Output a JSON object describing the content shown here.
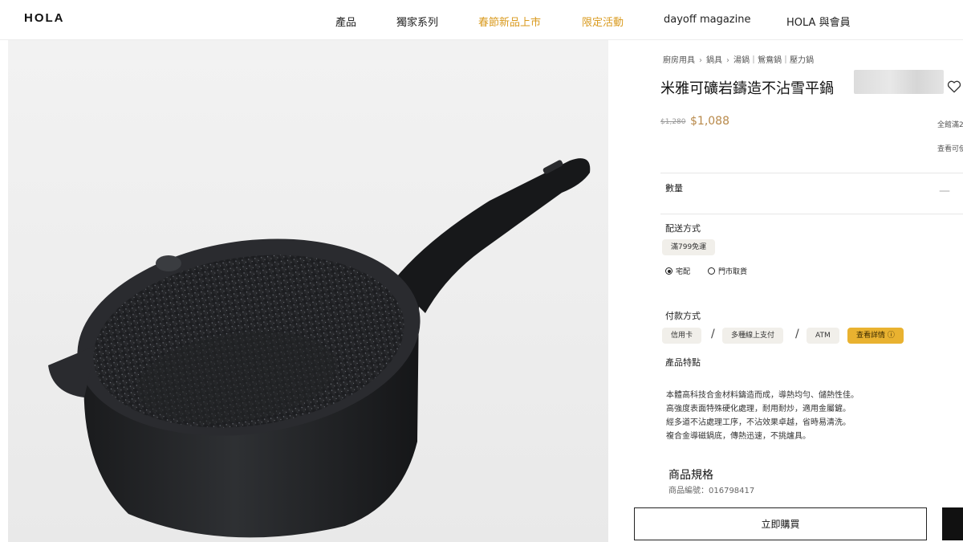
{
  "header": {
    "logo": "HOLA",
    "nav": [
      {
        "label": "產品",
        "highlight": false
      },
      {
        "label": "獨家系列",
        "highlight": false
      },
      {
        "label": "春節新品上市",
        "highlight": true
      },
      {
        "label": "限定活動",
        "highlight": true
      },
      {
        "label": "dayoff magazine",
        "highlight": false
      },
      {
        "label": "HOLA 與會員",
        "highlight": false
      }
    ],
    "highlight_color": "#d99a1e"
  },
  "product": {
    "image_icon": "frying-pan-image",
    "breadcrumb": [
      "廚房用具",
      "鍋具",
      "湯鍋｜鴛鴦鍋｜壓力鍋"
    ],
    "title": "米雅可礦岩鑄造不沾雪平鍋",
    "price_old": "$1,280",
    "price_new": "$1,088",
    "price_color": "#b8894a",
    "promo_lines": [
      "全館滿2",
      "查看可使"
    ],
    "quantity_label": "數量",
    "quantity_minus": "—",
    "shipping": {
      "label": "配送方式",
      "badge": "滿799免運",
      "options": [
        {
          "label": "宅配",
          "selected": true
        },
        {
          "label": "門市取貨",
          "selected": false
        }
      ]
    },
    "payment": {
      "label": "付款方式",
      "methods": [
        "信用卡",
        "多種線上支付",
        "ATM"
      ],
      "separator": "/",
      "details_label": "查看詳情"
    },
    "features_label": "產品特點",
    "features": [
      "本體高科技合金材料鑄造而成，導熱均勻、儲熱性佳。",
      "高強度表面特殊硬化處理，耐用耐炒，適用金屬鏟。",
      "經多道不沾處理工序，不沾效果卓越，省時易清洗。",
      "複合金導磁鍋底，傳熱迅速，不挑爐具。"
    ],
    "spec_title": "商品規格",
    "sku": "商品編號：016798417",
    "buy_label": "立即購買"
  }
}
